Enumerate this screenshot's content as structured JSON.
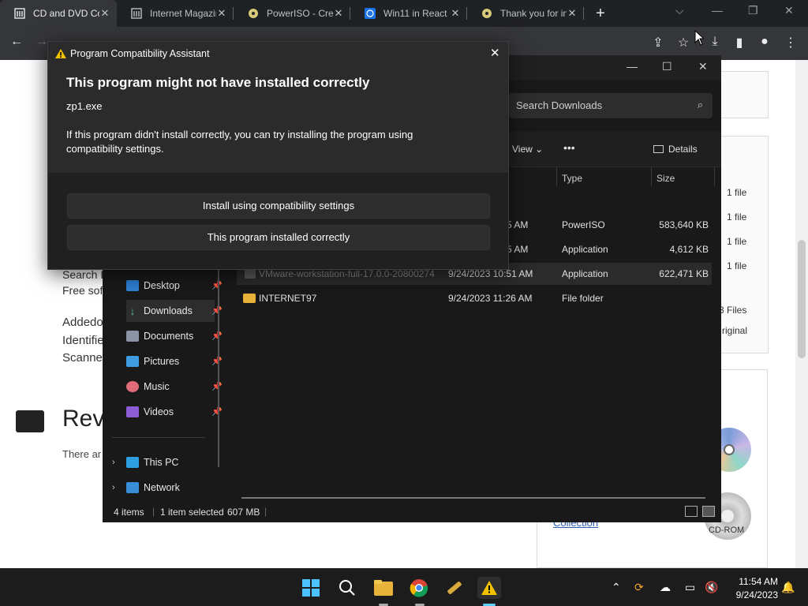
{
  "browser": {
    "tabs": [
      {
        "title": "CD and DVD Collection",
        "active": true
      },
      {
        "title": "Internet Magazine",
        "active": false
      },
      {
        "title": "PowerISO - Create",
        "active": false
      },
      {
        "title": "Win11 in React",
        "active": false
      },
      {
        "title": "Thank you for installing",
        "active": false
      }
    ],
    "new_tab": "+"
  },
  "page": {
    "search_frag": "Search I",
    "free_frag": "Free sof",
    "added_frag": "Addedo",
    "ident_frag": "Identifie",
    "scanned_frag": "Scanne",
    "rev_frag": "Rev",
    "there_frag": "There ar",
    "side_counts": [
      "1 file",
      "1 file",
      "1 file",
      "1 file"
    ],
    "files_frag": "3 Files",
    "original_frag": "riginal",
    "collection_link": "Collection",
    "cdrom_label": "CD-ROM"
  },
  "explorer": {
    "search_placeholder": "Search Downloads",
    "view_label": "View",
    "more_label": "•••",
    "details_label": "Details",
    "columns": {
      "type": "Type",
      "size": "Size"
    },
    "files": [
      {
        "name": "",
        "date": "5 AM",
        "type": "PowerISO",
        "size": "583,640 KB"
      },
      {
        "name": "",
        "date": "5 AM",
        "type": "Application",
        "size": "4,612 KB"
      },
      {
        "name": "VMware-workstation-full-17.0.0-20800274",
        "date": "9/24/2023 10:51 AM",
        "type": "Application",
        "size": "622,471 KB"
      },
      {
        "name": "INTERNET97",
        "date": "9/24/2023 11:26 AM",
        "type": "File folder",
        "size": ""
      }
    ],
    "nav": [
      {
        "label": "Desktop",
        "pinned": true
      },
      {
        "label": "Downloads",
        "pinned": true
      },
      {
        "label": "Documents",
        "pinned": true
      },
      {
        "label": "Pictures",
        "pinned": true
      },
      {
        "label": "Music",
        "pinned": true
      },
      {
        "label": "Videos",
        "pinned": true
      },
      {
        "label": "This PC",
        "pinned": false
      },
      {
        "label": "Network",
        "pinned": false
      }
    ],
    "status": {
      "count": "4 items",
      "selected": "1 item selected",
      "size": "607 MB"
    }
  },
  "dialog": {
    "title": "Program Compatibility Assistant",
    "heading": "This program might not have installed correctly",
    "program": "zp1.exe",
    "message": "If this program didn't install correctly, you can try installing the program using compatibility settings.",
    "btn_compat": "Install using compatibility settings",
    "btn_ok": "This program installed correctly"
  },
  "taskbar": {
    "time": "11:54 AM",
    "date": "9/24/2023"
  },
  "colors": {
    "accent": "#60cdff",
    "warning": "#f2c200",
    "folder": "#e8b33b"
  }
}
